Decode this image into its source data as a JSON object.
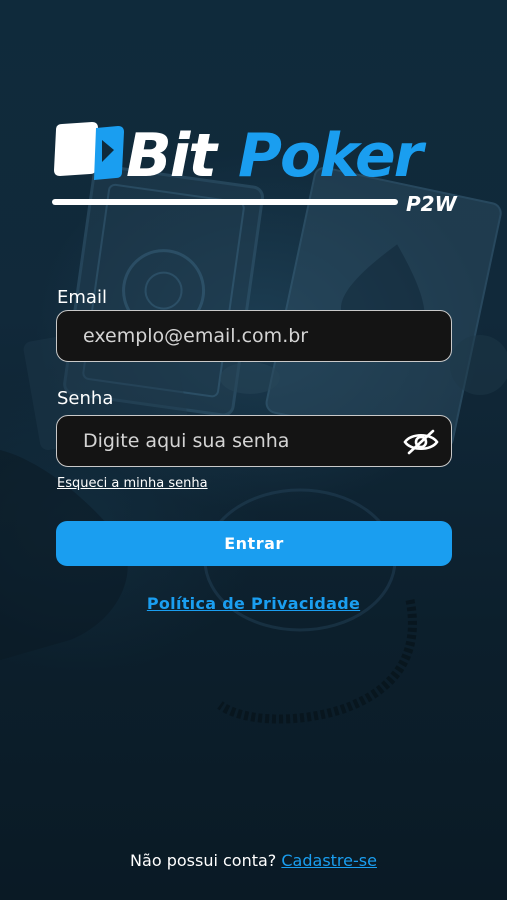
{
  "brand": {
    "name_part1": "Bit",
    "name_part2": "Poker",
    "tagline": "P2W",
    "accent_color": "#1a9ef0"
  },
  "form": {
    "email_label": "Email",
    "email_placeholder": "exemplo@email.com.br",
    "password_label": "Senha",
    "password_placeholder": "Digite aqui sua senha",
    "password_toggle_icon": "eye-off-icon",
    "forgot_link": "Esqueci a minha senha",
    "submit_label": "Entrar"
  },
  "privacy_link": "Política de Privacidade",
  "signup": {
    "prompt": "Não possui conta?",
    "link": "Cadastre-se"
  }
}
